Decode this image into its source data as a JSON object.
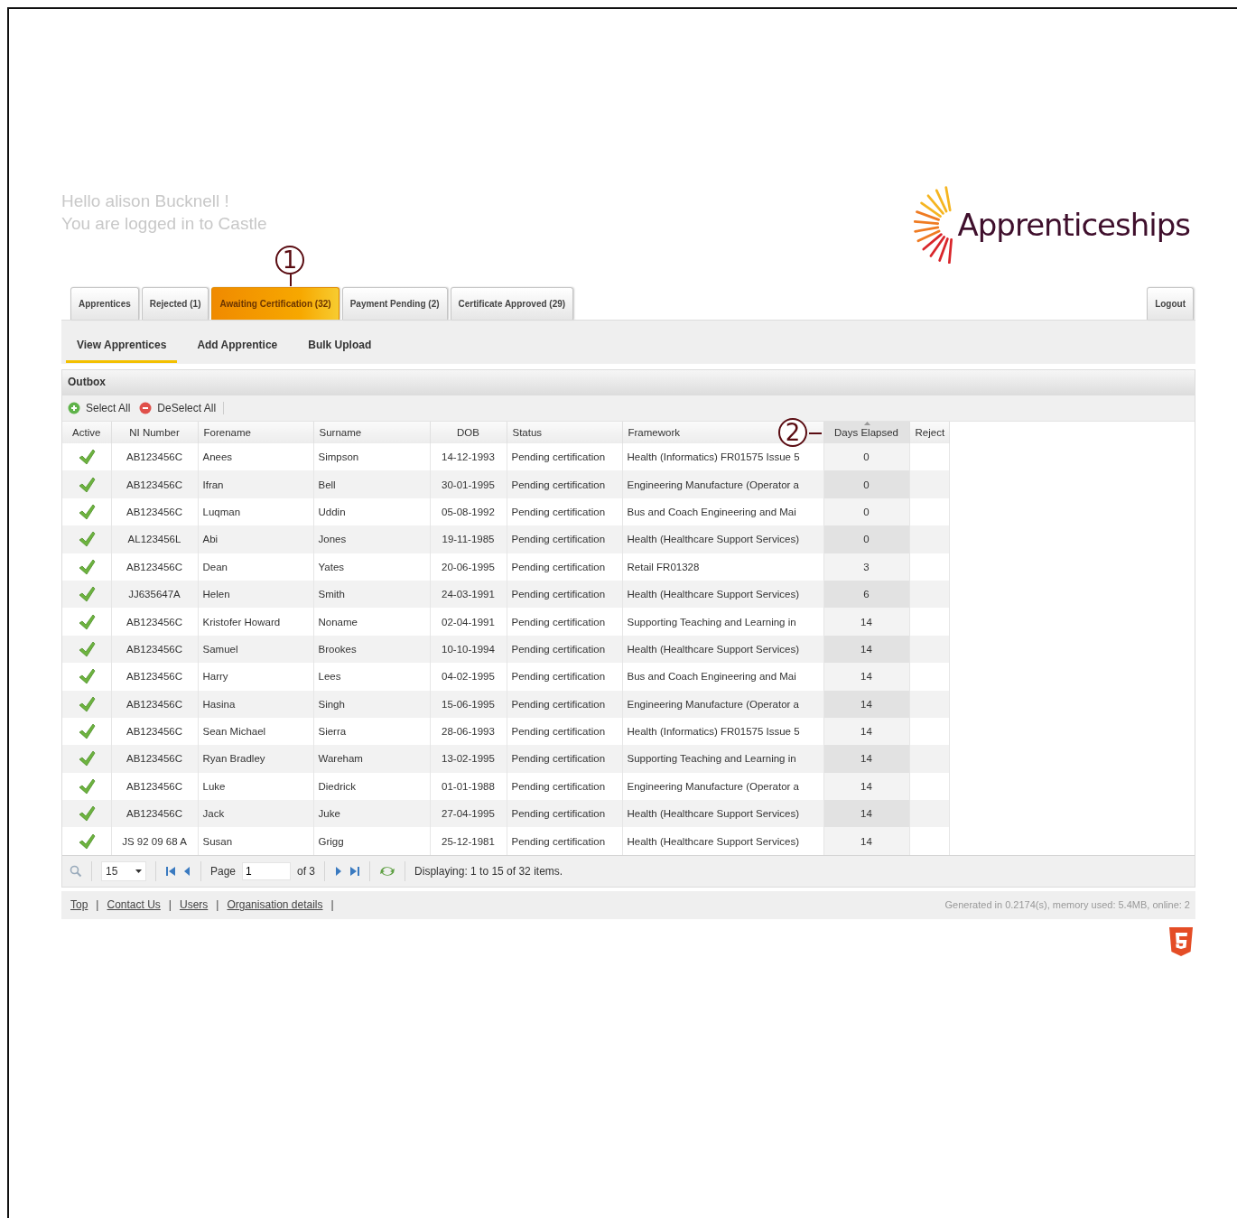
{
  "greeting": {
    "line1": "Hello alison Bucknell !",
    "line2": "You are logged in to Castle"
  },
  "logo": {
    "text": "Apprenticeships"
  },
  "tabs": [
    {
      "label": "Apprentices",
      "selected": false
    },
    {
      "label": "Rejected (1)",
      "selected": false
    },
    {
      "label": "Awaiting Certification (32)",
      "selected": true
    },
    {
      "label": "Payment Pending (2)",
      "selected": false
    },
    {
      "label": "Certificate Approved (29)",
      "selected": false
    }
  ],
  "logout": "Logout",
  "subnav": [
    {
      "label": "View Apprentices",
      "selected": true
    },
    {
      "label": "Add Apprentice",
      "selected": false
    },
    {
      "label": "Bulk Upload",
      "selected": false
    }
  ],
  "panel": {
    "title": "Outbox",
    "select_all": "Select All",
    "deselect_all": "DeSelect All"
  },
  "table": {
    "columns": [
      {
        "label": "Active",
        "sorted": false
      },
      {
        "label": "NI Number",
        "sorted": false
      },
      {
        "label": "Forename",
        "sorted": false
      },
      {
        "label": "Surname",
        "sorted": false
      },
      {
        "label": "DOB",
        "sorted": false
      },
      {
        "label": "Status",
        "sorted": false
      },
      {
        "label": "Framework",
        "sorted": false
      },
      {
        "label": "Days Elapsed",
        "sorted": true
      },
      {
        "label": "Reject",
        "sorted": false
      }
    ],
    "rows": [
      {
        "active": true,
        "ni": "AB123456C",
        "forename": "Anees",
        "surname": "Simpson",
        "dob": "14-12-1993",
        "status": "Pending certification",
        "framework": "Health (Informatics) FR01575 Issue 5",
        "days": "0"
      },
      {
        "active": true,
        "ni": "AB123456C",
        "forename": "Ifran",
        "surname": "Bell",
        "dob": "30-01-1995",
        "status": "Pending certification",
        "framework": "Engineering Manufacture (Operator a",
        "days": "0"
      },
      {
        "active": true,
        "ni": "AB123456C",
        "forename": "Luqman",
        "surname": "Uddin",
        "dob": "05-08-1992",
        "status": "Pending certification",
        "framework": "Bus and Coach Engineering and Mai",
        "days": "0"
      },
      {
        "active": true,
        "ni": "AL123456L",
        "forename": "Abi",
        "surname": "Jones",
        "dob": "19-11-1985",
        "status": "Pending certification",
        "framework": "Health (Healthcare Support Services)",
        "days": "0"
      },
      {
        "active": true,
        "ni": "AB123456C",
        "forename": "Dean",
        "surname": "Yates",
        "dob": "20-06-1995",
        "status": "Pending certification",
        "framework": "Retail FR01328",
        "days": "3"
      },
      {
        "active": true,
        "ni": "JJ635647A",
        "forename": "Helen",
        "surname": "Smith",
        "dob": "24-03-1991",
        "status": "Pending certification",
        "framework": "Health (Healthcare Support Services)",
        "days": "6"
      },
      {
        "active": true,
        "ni": "AB123456C",
        "forename": "Kristofer Howard",
        "surname": "Noname",
        "dob": "02-04-1991",
        "status": "Pending certification",
        "framework": "Supporting Teaching and Learning in",
        "days": "14"
      },
      {
        "active": true,
        "ni": "AB123456C",
        "forename": "Samuel",
        "surname": "Brookes",
        "dob": "10-10-1994",
        "status": "Pending certification",
        "framework": "Health (Healthcare Support Services)",
        "days": "14"
      },
      {
        "active": true,
        "ni": "AB123456C",
        "forename": "Harry",
        "surname": "Lees",
        "dob": "04-02-1995",
        "status": "Pending certification",
        "framework": "Bus and Coach Engineering and Mai",
        "days": "14"
      },
      {
        "active": true,
        "ni": "AB123456C",
        "forename": "Hasina",
        "surname": "Singh",
        "dob": "15-06-1995",
        "status": "Pending certification",
        "framework": "Engineering Manufacture (Operator a",
        "days": "14"
      },
      {
        "active": true,
        "ni": "AB123456C",
        "forename": "Sean Michael",
        "surname": "Sierra",
        "dob": "28-06-1993",
        "status": "Pending certification",
        "framework": "Health (Informatics) FR01575 Issue 5",
        "days": "14"
      },
      {
        "active": true,
        "ni": "AB123456C",
        "forename": "Ryan Bradley",
        "surname": "Wareham",
        "dob": "13-02-1995",
        "status": "Pending certification",
        "framework": "Supporting Teaching and Learning in",
        "days": "14"
      },
      {
        "active": true,
        "ni": "AB123456C",
        "forename": "Luke",
        "surname": "Diedrick",
        "dob": "01-01-1988",
        "status": "Pending certification",
        "framework": "Engineering Manufacture (Operator a",
        "days": "14"
      },
      {
        "active": true,
        "ni": "AB123456C",
        "forename": "Jack",
        "surname": "Juke",
        "dob": "27-04-1995",
        "status": "Pending certification",
        "framework": "Health (Healthcare Support Services)",
        "days": "14"
      },
      {
        "active": true,
        "ni": "JS 92 09 68 A",
        "forename": "Susan",
        "surname": "Grigg",
        "dob": "25-12-1981",
        "status": "Pending certification",
        "framework": "Health (Healthcare Support Services)",
        "days": "14"
      }
    ]
  },
  "pager": {
    "page_size": "15",
    "page_label": "Page",
    "page": "1",
    "of": "of 3",
    "display": "Displaying: 1 to 15 of 32 items."
  },
  "footer": {
    "links": [
      {
        "label": "Top",
        "separator": "|"
      },
      {
        "label": "Contact Us",
        "separator": "|"
      },
      {
        "label": "Users",
        "separator": "|"
      },
      {
        "label": "Organisation details",
        "separator": "|"
      }
    ],
    "generated": "Generated in 0.2174(s), memory used: 5.4MB, online: 2"
  },
  "annotations": [
    {
      "label": "1"
    },
    {
      "label": "2"
    }
  ]
}
